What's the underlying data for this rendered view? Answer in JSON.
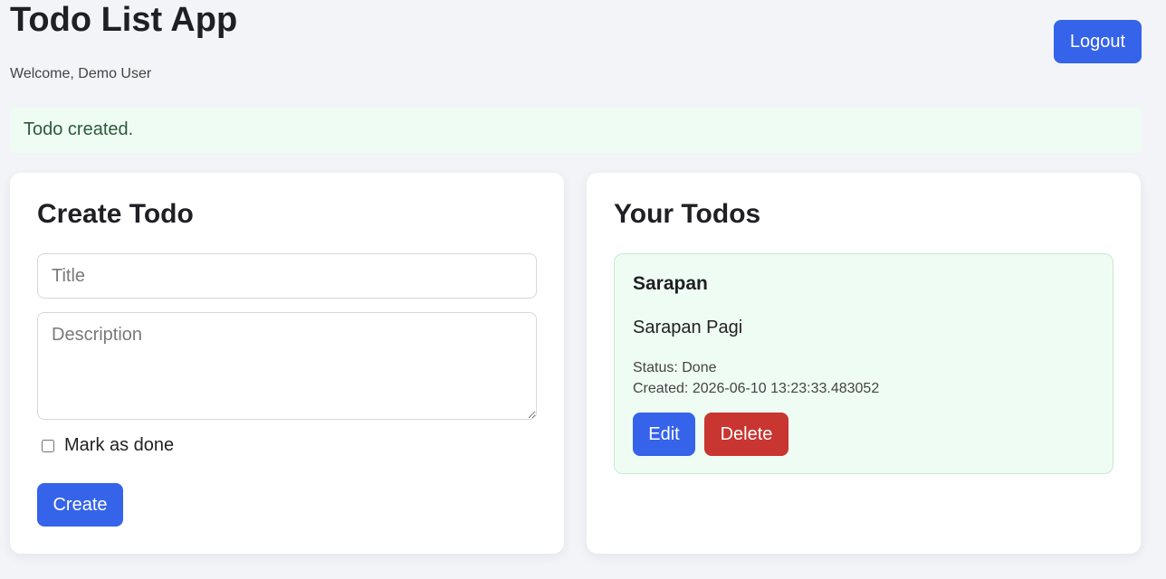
{
  "header": {
    "title": "Todo List App",
    "welcome": "Welcome, Demo User",
    "logout_label": "Logout"
  },
  "flash": {
    "message": "Todo created."
  },
  "create_form": {
    "heading": "Create Todo",
    "title_placeholder": "Title",
    "title_value": "",
    "description_placeholder": "Description",
    "description_value": "",
    "done_label": "Mark as done",
    "done_checked": false,
    "submit_label": "Create"
  },
  "todos": {
    "heading": "Your Todos",
    "items": [
      {
        "title": "Sarapan",
        "description": "Sarapan Pagi",
        "status_text": "Status: Done",
        "created_text": "Created: 2026-06-10 13:23:33.483052",
        "edit_label": "Edit",
        "delete_label": "Delete"
      }
    ]
  },
  "colors": {
    "primary": "#3563e9",
    "danger": "#c93530",
    "success_bg": "#effcf3",
    "page_bg": "#f3f4f8"
  }
}
